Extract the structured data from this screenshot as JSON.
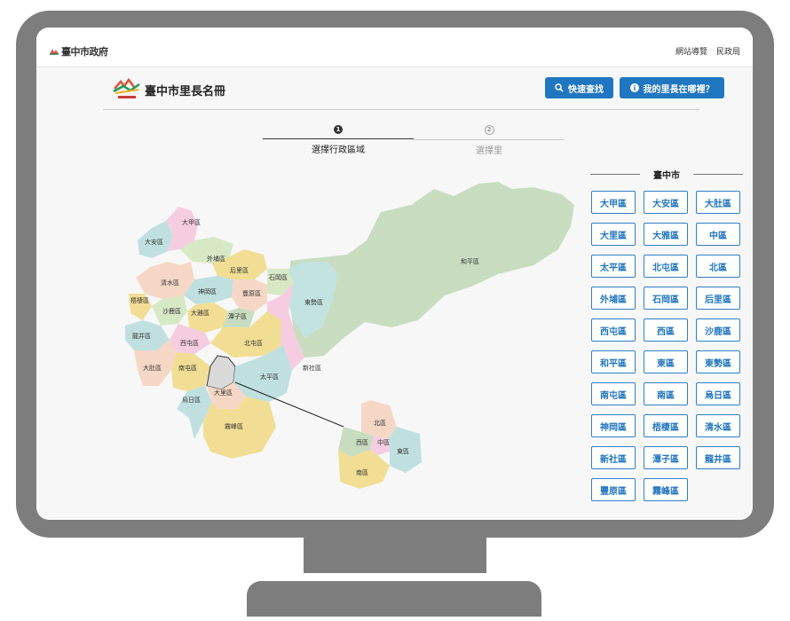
{
  "topbar": {
    "gov_logo_text": "臺中市政府",
    "links": [
      "網站導覽",
      "民政局"
    ]
  },
  "header": {
    "title": "臺中市里長名冊",
    "logo_text": "臺中市政府",
    "quick_search": "快速查找",
    "where_is": "我的里長在哪裡？"
  },
  "steps": [
    {
      "num": "1",
      "label": "選擇行政區域"
    },
    {
      "num": "2",
      "label": "選擇里"
    }
  ],
  "map": {
    "labels": [
      "大安區",
      "大甲區",
      "外埔區",
      "后里區",
      "清水區",
      "梧棲區",
      "沙鹿區",
      "神岡區",
      "豐原區",
      "石岡區",
      "大雅區",
      "潭子區",
      "龍井區",
      "西屯區",
      "北屯區",
      "東勢區",
      "大肚區",
      "南屯區",
      "太平區",
      "新社區",
      "烏日區",
      "大里區",
      "霧峰區",
      "和平區",
      "北區",
      "西區",
      "中區",
      "東區",
      "南區"
    ]
  },
  "sidebar": {
    "city": "臺中市",
    "districts": [
      "大甲區",
      "大安區",
      "大肚區",
      "大里區",
      "大雅區",
      "中區",
      "太平區",
      "北屯區",
      "北區",
      "外埔區",
      "石岡區",
      "后里區",
      "西屯區",
      "西區",
      "沙鹿區",
      "和平區",
      "東區",
      "東勢區",
      "南屯區",
      "南區",
      "烏日區",
      "神岡區",
      "梧棲區",
      "清水區",
      "新社區",
      "潭子區",
      "龍井區",
      "豐原區",
      "霧峰區"
    ]
  },
  "colors": {
    "accent": "#2176c0",
    "bezel": "#7d7d7d"
  }
}
